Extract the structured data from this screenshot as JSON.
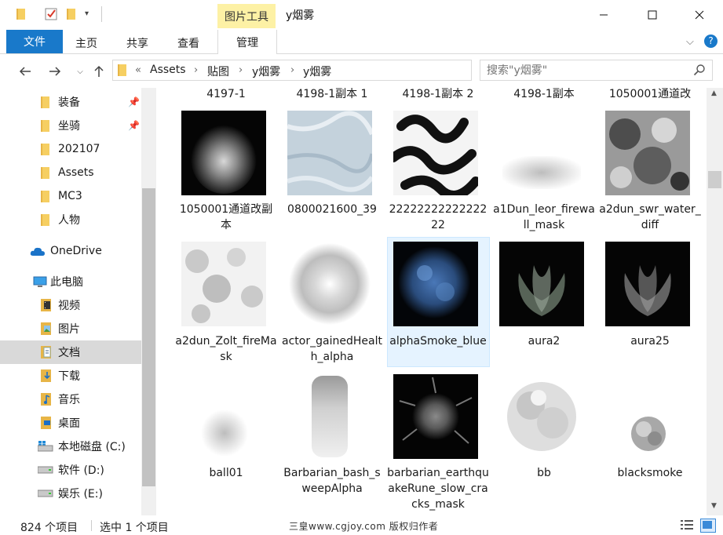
{
  "window": {
    "title": "y烟雾",
    "context_tab_header": "图片工具",
    "controls": [
      "minimize",
      "maximize",
      "close"
    ]
  },
  "ribbon": {
    "tabs": [
      {
        "label": "文件"
      },
      {
        "label": "主页"
      },
      {
        "label": "共享"
      },
      {
        "label": "查看"
      },
      {
        "label": "管理"
      }
    ]
  },
  "address": {
    "overflow": "«",
    "crumbs": [
      "Assets",
      "贴图",
      "y烟雾",
      "y烟雾"
    ]
  },
  "search": {
    "placeholder": "搜索\"y烟雾\""
  },
  "navpane": {
    "quick_access": [
      {
        "label": "装备",
        "pinned": true
      },
      {
        "label": "坐骑",
        "pinned": true
      },
      {
        "label": "202107"
      },
      {
        "label": "Assets"
      },
      {
        "label": "MC3"
      },
      {
        "label": "人物"
      }
    ],
    "onedrive": "OneDrive",
    "this_pc": "此电脑",
    "pc_items": [
      {
        "label": "视频",
        "icon": "video-folder-icon"
      },
      {
        "label": "图片",
        "icon": "pictures-folder-icon"
      },
      {
        "label": "文档",
        "icon": "documents-folder-icon"
      },
      {
        "label": "下载",
        "icon": "downloads-folder-icon"
      },
      {
        "label": "音乐",
        "icon": "music-folder-icon"
      },
      {
        "label": "桌面",
        "icon": "desktop-folder-icon"
      },
      {
        "label": "本地磁盘 (C:)",
        "icon": "windows-drive-icon"
      },
      {
        "label": "软件 (D:)",
        "icon": "drive-icon"
      },
      {
        "label": "娱乐 (E:)",
        "icon": "drive-icon"
      }
    ]
  },
  "files": {
    "top_row": [
      "4197-1",
      "4198-1副本 1",
      "4198-1副本 2",
      "4198-1副本",
      "1050001通道改"
    ],
    "row1": [
      {
        "name": "1050001通道改副本"
      },
      {
        "name": "0800021600_39"
      },
      {
        "name": "2222222222222222"
      },
      {
        "name": "a1Dun_leor_firewall_mask"
      },
      {
        "name": "a2dun_swr_water_diff"
      }
    ],
    "row2": [
      {
        "name": "a2dun_Zolt_fireMask"
      },
      {
        "name": "actor_gainedHealth_alpha"
      },
      {
        "name": "alphaSmoke_blue",
        "selected": true
      },
      {
        "name": "aura2"
      },
      {
        "name": "aura25"
      }
    ],
    "row3": [
      {
        "name": "ball01"
      },
      {
        "name": "Barbarian_bash_sweepAlpha"
      },
      {
        "name": "barbarian_earthquakeRune_slow_cracks_mask"
      },
      {
        "name": "bb"
      },
      {
        "name": "blacksmoke"
      }
    ]
  },
  "status": {
    "item_count": "824 个项目",
    "selected": "选中 1 个项目",
    "watermark": "三皇www.cgjoy.com 版权归作者"
  }
}
